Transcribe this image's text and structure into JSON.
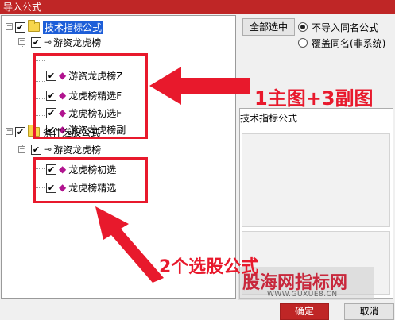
{
  "window": {
    "title": "导入公式"
  },
  "tree": {
    "items": [
      {
        "label": "技术指标公式",
        "checked": "✔"
      },
      {
        "label": "游资龙虎榜",
        "checked": "✔"
      },
      {
        "label": "游资龙虎榜Z",
        "checked": "✔"
      },
      {
        "label": "龙虎榜精选F",
        "checked": "✔"
      },
      {
        "label": "龙虎榜初选F",
        "checked": "✔"
      },
      {
        "label": "游资龙虎榜副",
        "checked": "✔"
      },
      {
        "label": "条件选股公式",
        "checked": "✔"
      },
      {
        "label": "游资龙虎榜",
        "checked": "✔"
      },
      {
        "label": "龙虎榜初选",
        "checked": "✔"
      },
      {
        "label": "龙虎榜精选",
        "checked": "✔"
      }
    ],
    "expander": "−"
  },
  "toolbar": {
    "select_all_label": "全部选中",
    "radio_skip_label": "不导入同名公式",
    "radio_overwrite_label": "覆盖同名(非系统)"
  },
  "description": {
    "label": "技术指标公式"
  },
  "annotations": {
    "top": "1主图+3副图",
    "bottom": "2个选股公式"
  },
  "watermark": {
    "text": "股海网指标网",
    "url": "WWW.GUXUE8.CN"
  },
  "footer": {
    "ok_label": "确定",
    "cancel_label": "取消"
  },
  "colors": {
    "titlebar": "#bf2626",
    "annotation": "#e8192c",
    "selected": "#1d5ed8",
    "diamond": "#b1148f"
  }
}
